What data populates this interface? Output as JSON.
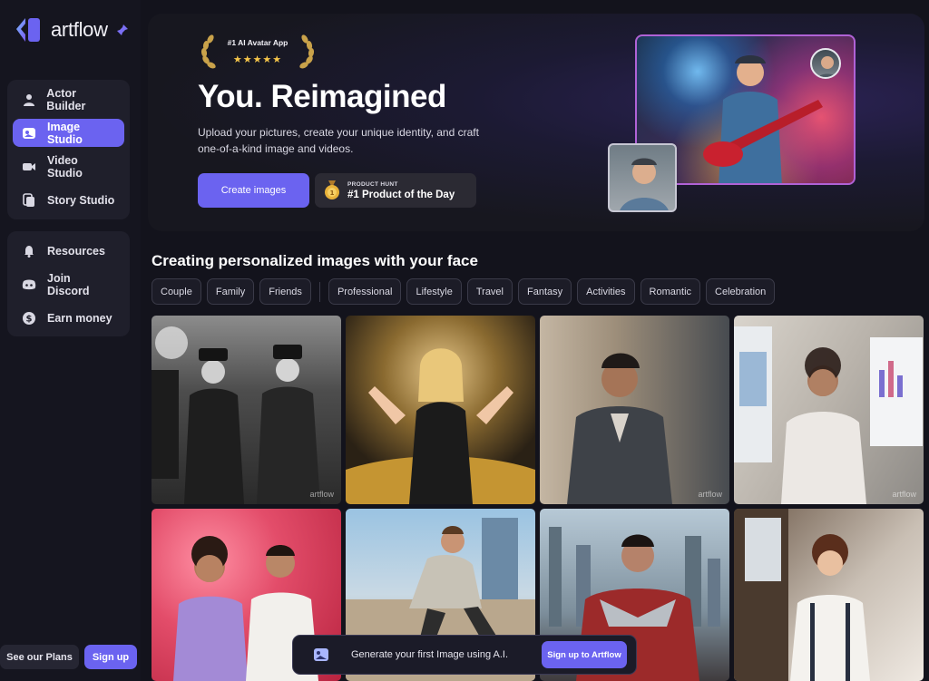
{
  "brand": {
    "name": "artflow",
    "accent": "#6b63f0"
  },
  "sidebar": {
    "primary": [
      {
        "label": "Actor Builder",
        "icon": "person-icon",
        "active": false
      },
      {
        "label": "Image Studio",
        "icon": "image-studio-icon",
        "active": true
      },
      {
        "label": "Video Studio",
        "icon": "video-camera-icon",
        "active": false
      },
      {
        "label": "Story Studio",
        "icon": "story-icon",
        "active": false
      }
    ],
    "secondary": [
      {
        "label": "Resources",
        "icon": "bell-icon"
      },
      {
        "label": "Join Discord",
        "icon": "discord-icon"
      },
      {
        "label": "Earn money",
        "icon": "dollar-icon"
      }
    ],
    "plans_label": "See our Plans",
    "signup_label": "Sign up"
  },
  "hero": {
    "award_title": "#1 AI Avatar App",
    "award_stars": "★★★★★",
    "title": "You. Reimagined",
    "subtitle": "Upload your pictures, create your unique identity, and craft one-of-a-kind image and videos.",
    "cta_label": "Create images",
    "ph_small": "PRODUCT HUNT",
    "ph_big": "#1 Product of the Day"
  },
  "section": {
    "title": "Creating personalized images with your face",
    "chips_group1": [
      "Couple",
      "Family",
      "Friends"
    ],
    "chips_group2": [
      "Professional",
      "Lifestyle",
      "Travel",
      "Fantasy",
      "Activities",
      "Romantic",
      "Celebration"
    ]
  },
  "gallery": {
    "watermark": "artflow"
  },
  "banner": {
    "text": "Generate your first Image using A.I.",
    "button_label": "Sign up to Artflow"
  }
}
